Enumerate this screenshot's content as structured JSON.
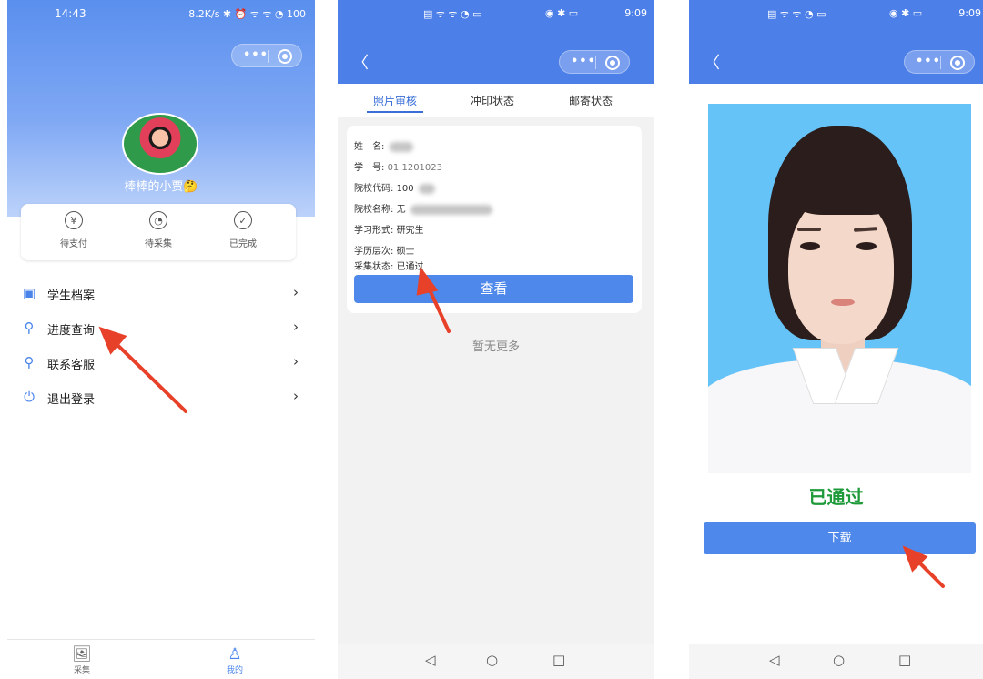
{
  "phone1": {
    "status_time": "14:43",
    "status_right": "8.2K/s ✱ ⏰ ᯤ ᯤ ◔ 100",
    "nickname": "棒棒的小贾🤔",
    "orders": [
      {
        "label": "待支付",
        "icon": "¥"
      },
      {
        "label": "待采集",
        "icon": "◔"
      },
      {
        "label": "已完成",
        "icon": "✓"
      }
    ],
    "menu": [
      {
        "label": "学生档案"
      },
      {
        "label": "进度查询"
      },
      {
        "label": "联系客服"
      },
      {
        "label": "退出登录"
      }
    ],
    "tabbar": {
      "collect": "采集",
      "mine": "我的"
    },
    "colors": {
      "header": "#5a8fee",
      "accent": "#4a84ea"
    }
  },
  "phone2": {
    "status_right": "9:09",
    "tabs": [
      "照片审核",
      "冲印状态",
      "邮寄状态"
    ],
    "record": {
      "name_label": "姓　名:",
      "id_label": "学　号:",
      "id_value": "01 1201023",
      "school_code_label": "院校代码:",
      "school_code_value": "100",
      "school_name_label": "院校名称:",
      "school_name_value": "无",
      "study_form_label": "学习形式:",
      "study_form_value": "研究生",
      "degree_label": "学历层次:",
      "degree_value": "硕士",
      "status_label": "采集状态:",
      "status_value": "已通过"
    },
    "view_button": "查看",
    "no_more": "暂无更多"
  },
  "phone3": {
    "status_right": "9:09",
    "result": "已通过",
    "download_button": "下载",
    "colors": {
      "result": "#1f9a3a",
      "photo_bg": "#66c3f7",
      "button": "#4e88ea"
    }
  },
  "annotation": {
    "arrow_color": "#e8412a"
  }
}
